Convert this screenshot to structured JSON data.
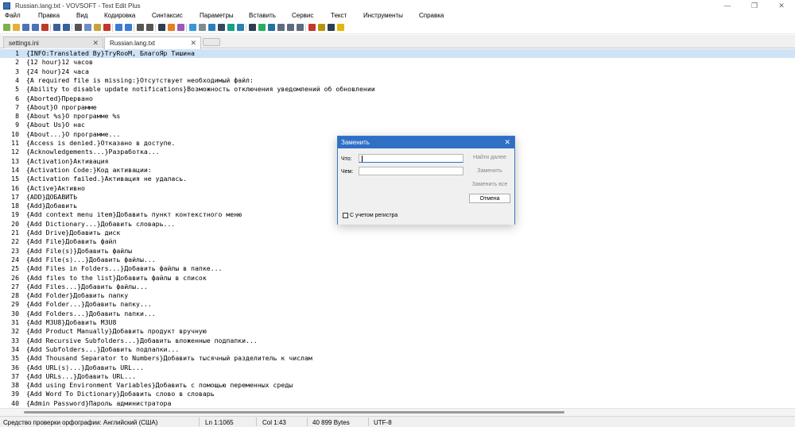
{
  "window": {
    "title": "Russian.lang.txt - VOVSOFT - Text Edit Plus",
    "minimize_glyph": "—",
    "restore_glyph": "❐",
    "close_glyph": "✕"
  },
  "menu": [
    "Файл",
    "Правка",
    "Вид",
    "Кодировка",
    "Синтаксис",
    "Параметры",
    "Вставить",
    "Сервис",
    "Текст",
    "Инструменты",
    "Справка"
  ],
  "toolbar": {
    "icons": [
      {
        "name": "new-file-icon",
        "color": "#7fb24a"
      },
      {
        "name": "open-file-icon",
        "color": "#e3b23c"
      },
      {
        "name": "save-icon",
        "color": "#4a74b5"
      },
      {
        "name": "save-all-icon",
        "color": "#4a74b5"
      },
      {
        "name": "close-file-icon",
        "color": "#c0392b"
      },
      {
        "name": "undo-icon",
        "color": "#3a5f9e"
      },
      {
        "name": "redo-icon",
        "color": "#3a5f9e"
      },
      {
        "name": "cut-icon",
        "color": "#555555"
      },
      {
        "name": "copy-icon",
        "color": "#6c8fc7"
      },
      {
        "name": "paste-icon",
        "color": "#c9a43a"
      },
      {
        "name": "delete-icon",
        "color": "#c0392b"
      },
      {
        "name": "find-icon",
        "color": "#3a7bd5"
      },
      {
        "name": "replace-icon",
        "color": "#3a7bd5"
      },
      {
        "name": "print-icon",
        "color": "#555555"
      },
      {
        "name": "print-preview-icon",
        "color": "#555555"
      },
      {
        "name": "font-icon",
        "color": "#2c3e50"
      },
      {
        "name": "color-icon",
        "color": "#e67e22"
      },
      {
        "name": "palette-icon",
        "color": "#9b59b6"
      },
      {
        "name": "filter-icon",
        "color": "#3498db"
      },
      {
        "name": "list-icon",
        "color": "#7f8c8d"
      },
      {
        "name": "email-icon",
        "color": "#2980b9"
      },
      {
        "name": "table-icon",
        "color": "#34495e"
      },
      {
        "name": "image-icon",
        "color": "#16a085"
      },
      {
        "name": "link-icon",
        "color": "#2980b9"
      },
      {
        "name": "arrow-right-icon",
        "color": "#2c3e50"
      },
      {
        "name": "download-icon",
        "color": "#27ae60"
      },
      {
        "name": "move-down-icon",
        "color": "#2471a3"
      },
      {
        "name": "indent-icon",
        "color": "#5d6d7e"
      },
      {
        "name": "sort-icon",
        "color": "#5d6d7e"
      },
      {
        "name": "wrap-icon",
        "color": "#5d6d7e"
      },
      {
        "name": "calendar-icon",
        "color": "#c0392b"
      },
      {
        "name": "lock-icon",
        "color": "#b7950b"
      },
      {
        "name": "text-icon",
        "color": "#2c3e50"
      },
      {
        "name": "note-icon",
        "color": "#e5b60b"
      }
    ]
  },
  "tabs": [
    {
      "label": "settings.ini",
      "close": "✕",
      "active": false
    },
    {
      "label": "Russian.lang.txt",
      "close": "✕",
      "active": true
    }
  ],
  "editor": {
    "current_line": 1,
    "lines": [
      "{INFO:Translated By}TryRooM, БлагоЯр Тишина",
      "{12 hour}12 часов",
      "{24 hour}24 часа",
      "{A required file is missing:}Отсутствует необходимый файл:",
      "{Ability to disable update notifications}Возможность отключения уведомлений об обновлении",
      "{Aborted}Прервано",
      "{About}О программе",
      "{About %s}О программе %s",
      "{About Us}О нас",
      "{About...}О программе...",
      "{Access is denied.}Отказано в доступе.",
      "{Acknowledgements...}Разработка...",
      "{Activation}Активация",
      "{Activation Code:}Код активации:",
      "{Activation failed.}Активация не удалась.",
      "{Active}Активно",
      "{ADD}ДОБАВИТЬ",
      "{Add}Добавить",
      "{Add context menu item}Добавить пункт контекстного меню",
      "{Add Dictionary...}Добавить словарь...",
      "{Add Drive}Добавить диск",
      "{Add File}Добавить файл",
      "{Add File(s)}Добавить файлы",
      "{Add File(s)...}Добавить файлы...",
      "{Add Files in Folders...}Добавить файлы в папке...",
      "{Add files to the list}Добавить файлы в список",
      "{Add Files...}Добавить файлы...",
      "{Add Folder}Добавить папку",
      "{Add Folder...}Добавить папку...",
      "{Add Folders...}Добавить папки...",
      "{Add M3U8}Добавить M3U8",
      "{Add Product Manually}Добавить продукт вручную",
      "{Add Recursive Subfolders...}Добавить вложенные подпапки...",
      "{Add Subfolders...}Добавить подпапки...",
      "{Add Thousand Separator to Numbers}Добавить тысячный разделитель к числам",
      "{Add URL(s)...}Добавить URL...",
      "{Add URLs...}Добавить URL...",
      "{Add using Environment Variables}Добавить с помощью переменных среды",
      "{Add Word To Dictionary}Добавить слово в словарь",
      "{Admin Password}Пароль администратора"
    ]
  },
  "statusbar": {
    "spellcheck": "Средство проверки орфографии: Английский (США)",
    "line": "Ln 1:1065",
    "column": "Col 1:43",
    "size": "40 899 Bytes",
    "encoding": "UTF-8"
  },
  "dialog": {
    "title": "Заменить",
    "close": "✕",
    "find_label": "Что:",
    "find_value": "",
    "replace_label": "Чем:",
    "replace_value": "",
    "find_next_button": "Найти далее",
    "replace_button": "Заменить",
    "replace_all_button": "Заменить все",
    "cancel_button": "Отмена",
    "match_case_label": "С учетом регистра",
    "accent_color": "#2f6fc6"
  }
}
